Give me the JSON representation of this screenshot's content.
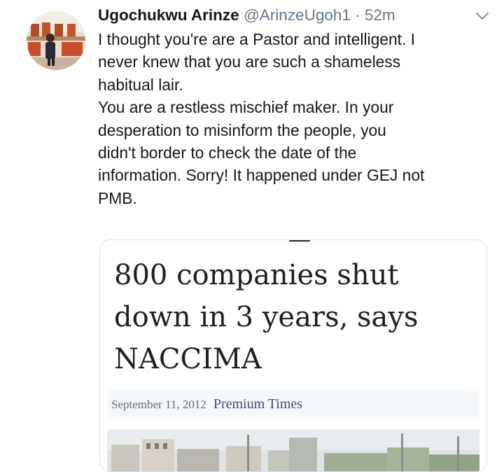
{
  "tweet": {
    "author_name": "Ugochukwu Arinze",
    "handle": "@ArinzeUgoh1",
    "separator": "·",
    "time_ago": "52m",
    "body_lines": [
      "I thought you're are a Pastor and intelligent. I",
      "never knew that you are such a shameless",
      "habitual lair.",
      "You are a restless mischief maker. In your",
      "desperation to misinform the people, you",
      "didn't border to check the date of the",
      "information. Sorry! It happened under GEJ not",
      "PMB."
    ],
    "icons": {
      "menu": "chevron-down-icon",
      "avatar": "profile-photo"
    }
  },
  "card": {
    "headline_lines": [
      "800 companies shut",
      "down in 3 years, says",
      "NACCIMA"
    ],
    "date": "September 11, 2012",
    "source": "Premium Times"
  },
  "colors": {
    "text_primary": "#14171a",
    "text_secondary": "#657786",
    "card_border": "#dde3e8",
    "source_link": "#3b4a7a"
  }
}
